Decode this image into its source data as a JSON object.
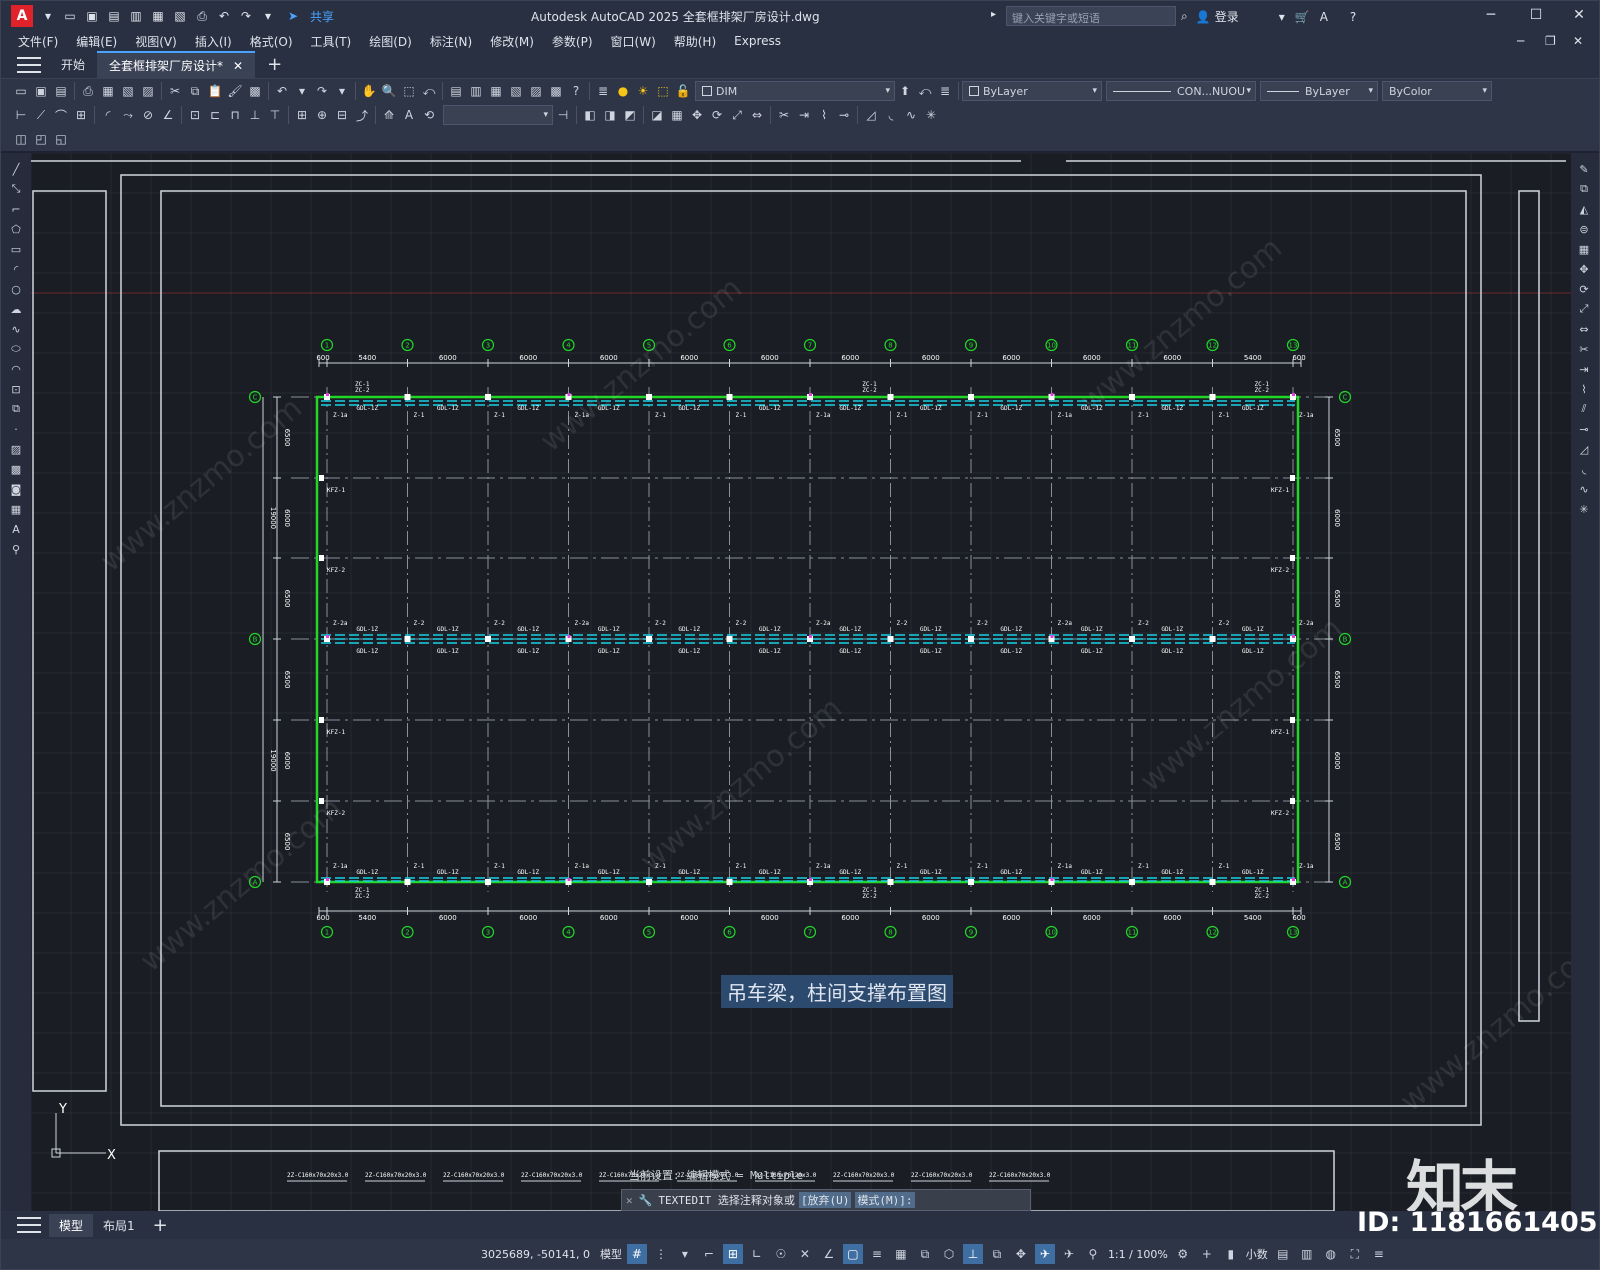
{
  "app": {
    "logo": "A",
    "title": "Autodesk AutoCAD 2025    全套框排架厂房设计.dwg",
    "share": "共享",
    "search_placeholder": "键入关键字或短语",
    "login": "登录"
  },
  "menus": [
    "文件(F)",
    "编辑(E)",
    "视图(V)",
    "插入(I)",
    "格式(O)",
    "工具(T)",
    "绘图(D)",
    "标注(N)",
    "修改(M)",
    "参数(P)",
    "窗口(W)",
    "帮助(H)",
    "Express"
  ],
  "tabs": {
    "start": "开始",
    "doc": "全套框排架厂房设计*"
  },
  "toolbar": {
    "layer": "DIM",
    "color": "ByLayer",
    "linetype": "CON...NUOU",
    "lineweight": "ByLayer",
    "plotstyle": "ByColor"
  },
  "drawing": {
    "top_dims": [
      "600",
      "5400",
      "6000",
      "6000",
      "6000",
      "6000",
      "6000",
      "6000",
      "6000",
      "6000",
      "6000",
      "6000",
      "5400",
      "600"
    ],
    "bottom_dims": [
      "600",
      "5400",
      "6000",
      "6000",
      "6000",
      "6000",
      "6000",
      "6000",
      "6000",
      "6000",
      "6000",
      "6000",
      "5400",
      "600"
    ],
    "left_dims": [
      "6500",
      "6000",
      "6500",
      "6500",
      "6000",
      "6500"
    ],
    "left_total": [
      "19000",
      "19000"
    ],
    "right_dims": [
      "6500",
      "6000",
      "6500",
      "6500",
      "6000",
      "6500"
    ],
    "col_axes": [
      "1",
      "2",
      "3",
      "4",
      "5",
      "6",
      "7",
      "8",
      "9",
      "10",
      "11",
      "12",
      "13"
    ],
    "row_axes": [
      "C",
      "B",
      "A"
    ],
    "beam_label": "GDL-1Z",
    "column_labels": {
      "a": "Z-1a",
      "b": "Z-1",
      "c": "Z-2",
      "d": "Z-2a"
    },
    "wind_labels": {
      "a": "KFZ-1",
      "b": "KFZ-2"
    },
    "brace_labels": {
      "a": "ZC-1",
      "b": "ZC-2"
    },
    "caption": "吊车梁，柱间支撑布置图",
    "bottom_labels": [
      "2Z-C160x70x20x3.0",
      "2Z-C160x70x20x3.0",
      "2Z-C160x70x20x3.0",
      "2Z-C160x70x20x3.0",
      "2Z-C160x70x20x3.0",
      "2Z-C160x70x20x3.0",
      "2Z-C160x70x20x3.0",
      "2Z-C160x70x20x3.0",
      "2Z-C160x70x20x3.0",
      "2Z-C160x70x20x3.0"
    ],
    "ucs": {
      "y": "Y",
      "x": "X"
    }
  },
  "command": {
    "status": "当前设置: 编辑模式 = Multiple",
    "prompt": "TEXTEDIT 选择注释对象或",
    "opt1": "[放弃(U)",
    "opt2": "模式(M)]:"
  },
  "watermark": {
    "brand": "知末",
    "id": "ID: 1181661405",
    "url": "www.znzmo.com"
  },
  "layout_tabs": {
    "model": "模型",
    "layout1": "布局1"
  },
  "status": {
    "coords": "3025689, -50141, 0",
    "model": "模型",
    "scale": "1:1 / 100%",
    "units": "小数"
  }
}
